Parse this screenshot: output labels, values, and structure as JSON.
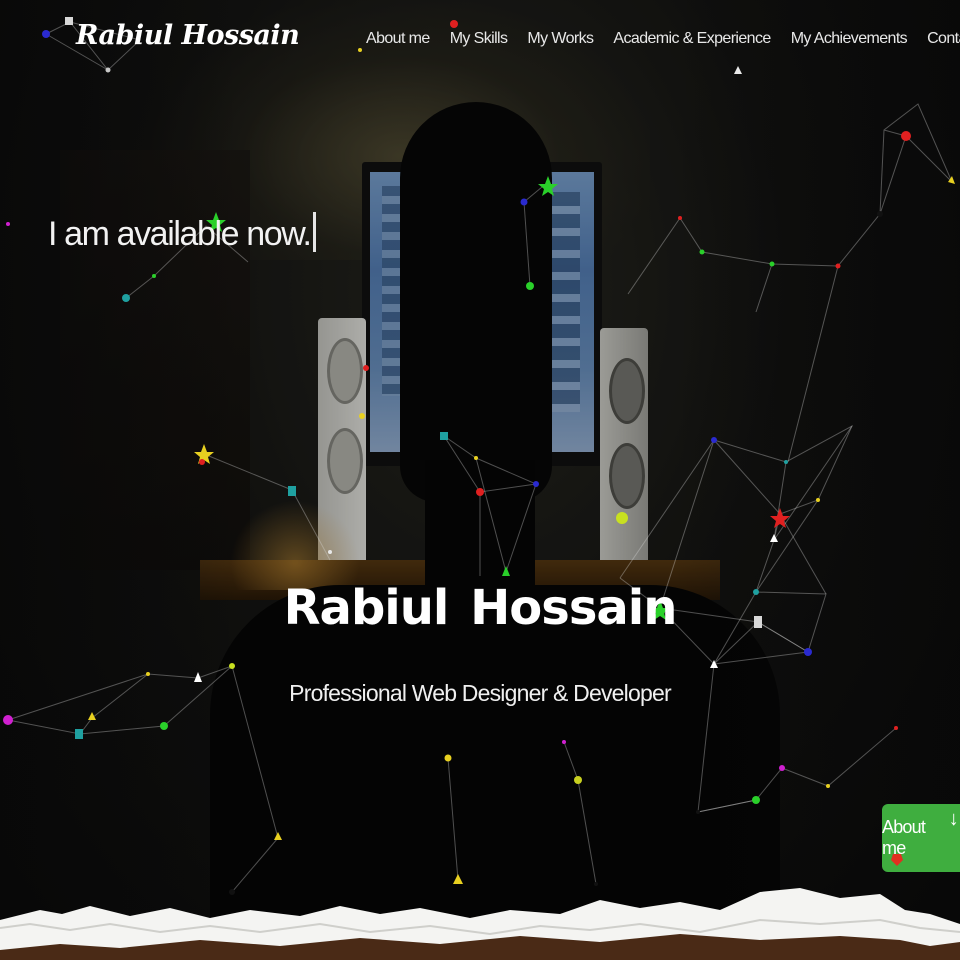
{
  "brand": {
    "logo_text": "Rabiul Hossain"
  },
  "nav": {
    "items": [
      {
        "label": "About me"
      },
      {
        "label": "My Skills"
      },
      {
        "label": "My Works"
      },
      {
        "label": "Academic & Experience"
      },
      {
        "label": "My Achievements"
      },
      {
        "label": "Contact me"
      }
    ]
  },
  "hero": {
    "typed_text": "I am available now.",
    "name": "Rabiul Hossain",
    "role": "Professional Web Designer & Developer"
  },
  "about_button": {
    "label": "About me",
    "icon": "arrow-down-icon"
  },
  "colors": {
    "accent_green": "#3fae3f",
    "paper_white": "#f4f4f2",
    "soil_brown": "#4a2a16"
  }
}
